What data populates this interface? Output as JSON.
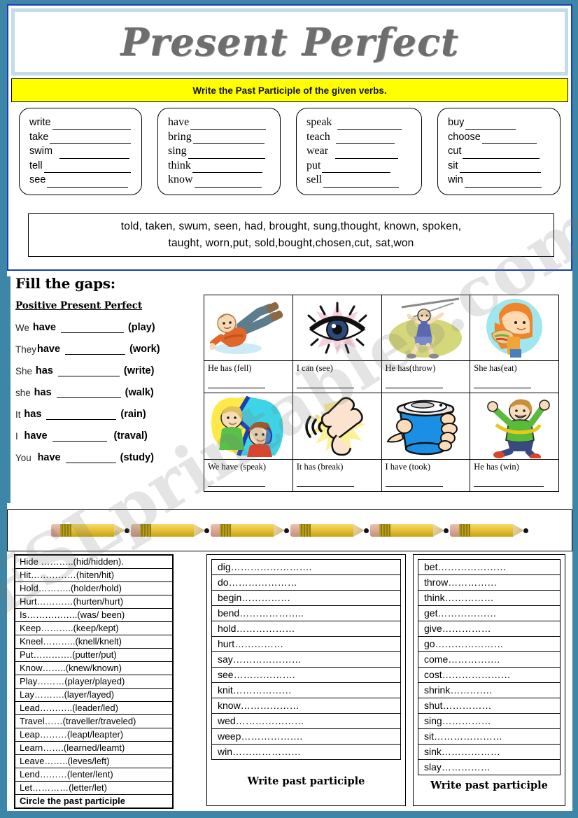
{
  "title": "Present Perfect",
  "instruction_banner": "Write the Past Participle of the given verbs.",
  "watermark": "ESLprintables.com",
  "colors": {
    "outer_border": "#3d86a8",
    "inner_border": "#1a3fb5",
    "title_frame": "#c2dcec",
    "banner": "#ffff00",
    "title_text": "#6e6e6e"
  },
  "verb_boxes": [
    {
      "name": "box-1",
      "verbs": [
        "write",
        "take",
        "swim",
        "tell",
        "see"
      ]
    },
    {
      "name": "box-2",
      "verbs": [
        "have",
        "bring",
        "sing",
        "think",
        "know"
      ]
    },
    {
      "name": "box-3",
      "verbs": [
        "speak",
        "teach",
        "wear",
        "put",
        "sell"
      ]
    },
    {
      "name": "box-4",
      "verbs": [
        "buy",
        "choose",
        "cut",
        "sit",
        "win"
      ]
    }
  ],
  "word_bank": {
    "line1": "told, taken, swum, seen, had, brought, sung,thought, known, spoken,",
    "line2": "taught, worn,put, sold,bought,chosen,cut, sat,won"
  },
  "fill_gaps": {
    "heading": "Fill the gaps:",
    "subheading": "Positive Present Perfect",
    "rows": [
      {
        "pronoun": "We",
        "aux": "have",
        "verb": "(play)"
      },
      {
        "pronoun": "They",
        "aux": "have",
        "verb": "(work)"
      },
      {
        "pronoun": "She",
        "aux": "has",
        "verb": "(write)"
      },
      {
        "pronoun": "she",
        "aux": "has",
        "verb": "(walk)"
      },
      {
        "pronoun": "It",
        "aux": "has",
        "verb": "(rain)"
      },
      {
        "pronoun": "I",
        "aux": "have",
        "verb": "(traval)"
      },
      {
        "pronoun": "You",
        "aux": "have",
        "verb": "(study)"
      }
    ]
  },
  "picture_grid": {
    "row1": [
      {
        "caption": "He has (fell)",
        "icon": "boy-falling-icon"
      },
      {
        "caption": "I can (see)",
        "icon": "eye-icon"
      },
      {
        "caption": "He has(throw)",
        "icon": "javelin-thrower-icon"
      },
      {
        "caption": "She has(eat)",
        "icon": "girl-eating-sandwich-icon"
      }
    ],
    "row2": [
      {
        "caption": "We have (speak)",
        "icon": "two-people-talking-icon"
      },
      {
        "caption": "It has (break)",
        "icon": "broken-bone-icon"
      },
      {
        "caption": "I have (took)",
        "icon": "hand-holding-cup-icon"
      },
      {
        "caption": "He has (win)",
        "icon": "boy-celebrating-icon"
      }
    ]
  },
  "pencil_divider": {
    "count": 6,
    "icon": "pencil-icon"
  },
  "bottom_left": {
    "items": [
      "Hide ………..(hid/hidden).",
      " Hit……………(hiten/hit)",
      "Hold………..(holder/hold)",
      "Hurt…………(hurten/hurt)",
      "Is……………..(was/ been)",
      "Keep………..(keep/kept)",
      "Kneel………..(knell/knelt)",
      "Put………….(putter/put)",
      "Know……..(knew/known)",
      "Play………(player/played)",
      "Lay……….(layer/layed)",
      "Lead………..(leader/led)",
      "Travel……(traveller/traveled)",
      "Leap………(leapt/leapter)",
      "Learn…….(learned/leamt)",
      "Leave……..(leves/left)",
      "Lend………(lenter/lent)",
      "Let…………(letter/let)"
    ],
    "footer": "Circle the past participle"
  },
  "bottom_middle": {
    "items": [
      "dig…………………….",
      "do…………………",
      "begin……………",
      "bend………………..",
      "hold………………",
      "hurt……………",
      "say…………………",
      "see……………….",
      "knit………………",
      "know………………",
      "wed…………………",
      "weep……………….",
      "win…………………"
    ],
    "footer": "Write past participle"
  },
  "bottom_right": {
    "items": [
      "bet…………………",
      "throw……………",
      "think……………",
      "get………………",
      "give……………",
      "go…………………",
      "come…………….",
      "cost…………………",
      "shrink………….",
      "shut……………",
      "sing……………",
      "sit…………………",
      "sink………………",
      "slay……………"
    ],
    "footer": "Write past participle"
  }
}
